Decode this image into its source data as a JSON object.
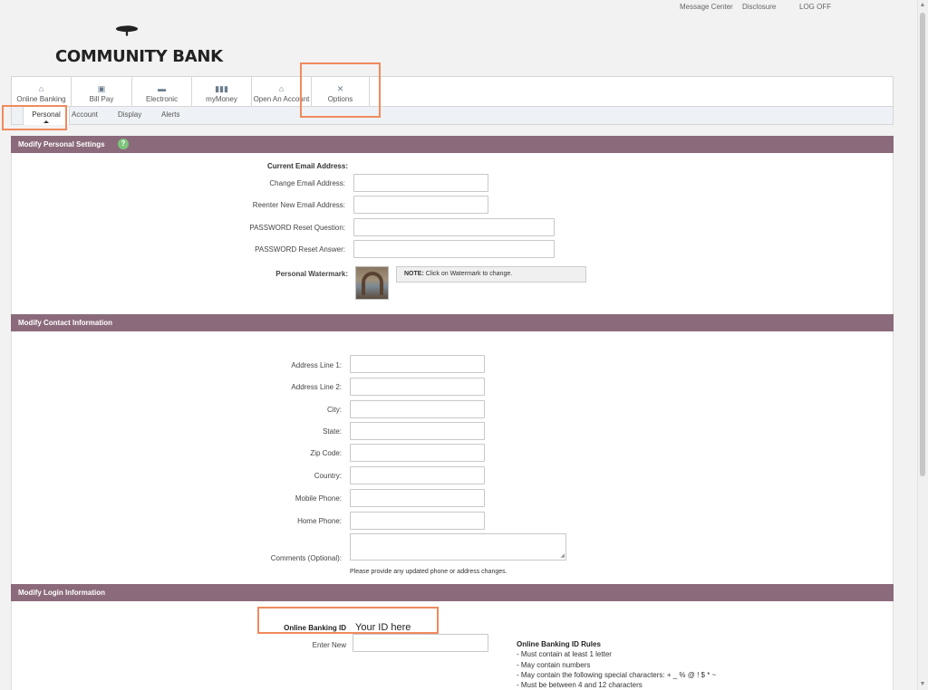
{
  "top_links": [
    "Message Center",
    "Disclosure",
    "LOG OFF"
  ],
  "brand": {
    "name": "COMMUNITY BANK"
  },
  "nav": {
    "items": [
      {
        "label": "Online Banking",
        "icon": "home-icon"
      },
      {
        "label": "Bill Pay",
        "icon": "wallet-icon"
      },
      {
        "label": "Electronic",
        "icon": "briefcase-icon"
      },
      {
        "label": "myMoney",
        "icon": "bar-chart-icon"
      },
      {
        "label": "Open An Account",
        "icon": "bank-icon"
      },
      {
        "label": "Options",
        "icon": "tools-icon"
      }
    ]
  },
  "subnav": {
    "items": [
      "Personal",
      "Account",
      "Display",
      "Alerts"
    ],
    "active": "Personal"
  },
  "personal": {
    "header": "Modify Personal Settings",
    "current_email_label": "Current Email Address:",
    "change_email_label": "Change Email Address:",
    "reenter_email_label": "Reenter New Email Address:",
    "reset_question_label": "PASSWORD Reset Question:",
    "reset_answer_label": "PASSWORD Reset Answer:",
    "watermark_label": "Personal Watermark:",
    "watermark_note_bold": "NOTE:",
    "watermark_note": " Click on Watermark to change."
  },
  "contact": {
    "header": "Modify Contact Information",
    "address1_label": "Address Line 1:",
    "address2_label": "Address Line 2:",
    "city_label": "City:",
    "state_label": "State:",
    "zip_label": "Zip Code:",
    "country_label": "Country:",
    "mobile_label": "Mobile Phone:",
    "home_label": "Home Phone:",
    "comments_label": "Comments (Optional):",
    "hint": "Please provide any updated phone or address changes."
  },
  "login": {
    "header": "Modify Login Information",
    "id_label": "Online Banking ID",
    "id_value": "Your ID here",
    "enter_new_label": "Enter New",
    "rules_title": "Online Banking ID Rules",
    "rules": [
      "- Must contain at least 1 letter",
      "- May contain numbers",
      "- May contain the following special characters: + _ % @ ! $ * ~",
      "- Must be between 4 and 12 characters"
    ]
  },
  "colors": {
    "section_header": "#8b6a7b",
    "highlight": "#f08a5d",
    "help": "#7cc47a"
  }
}
